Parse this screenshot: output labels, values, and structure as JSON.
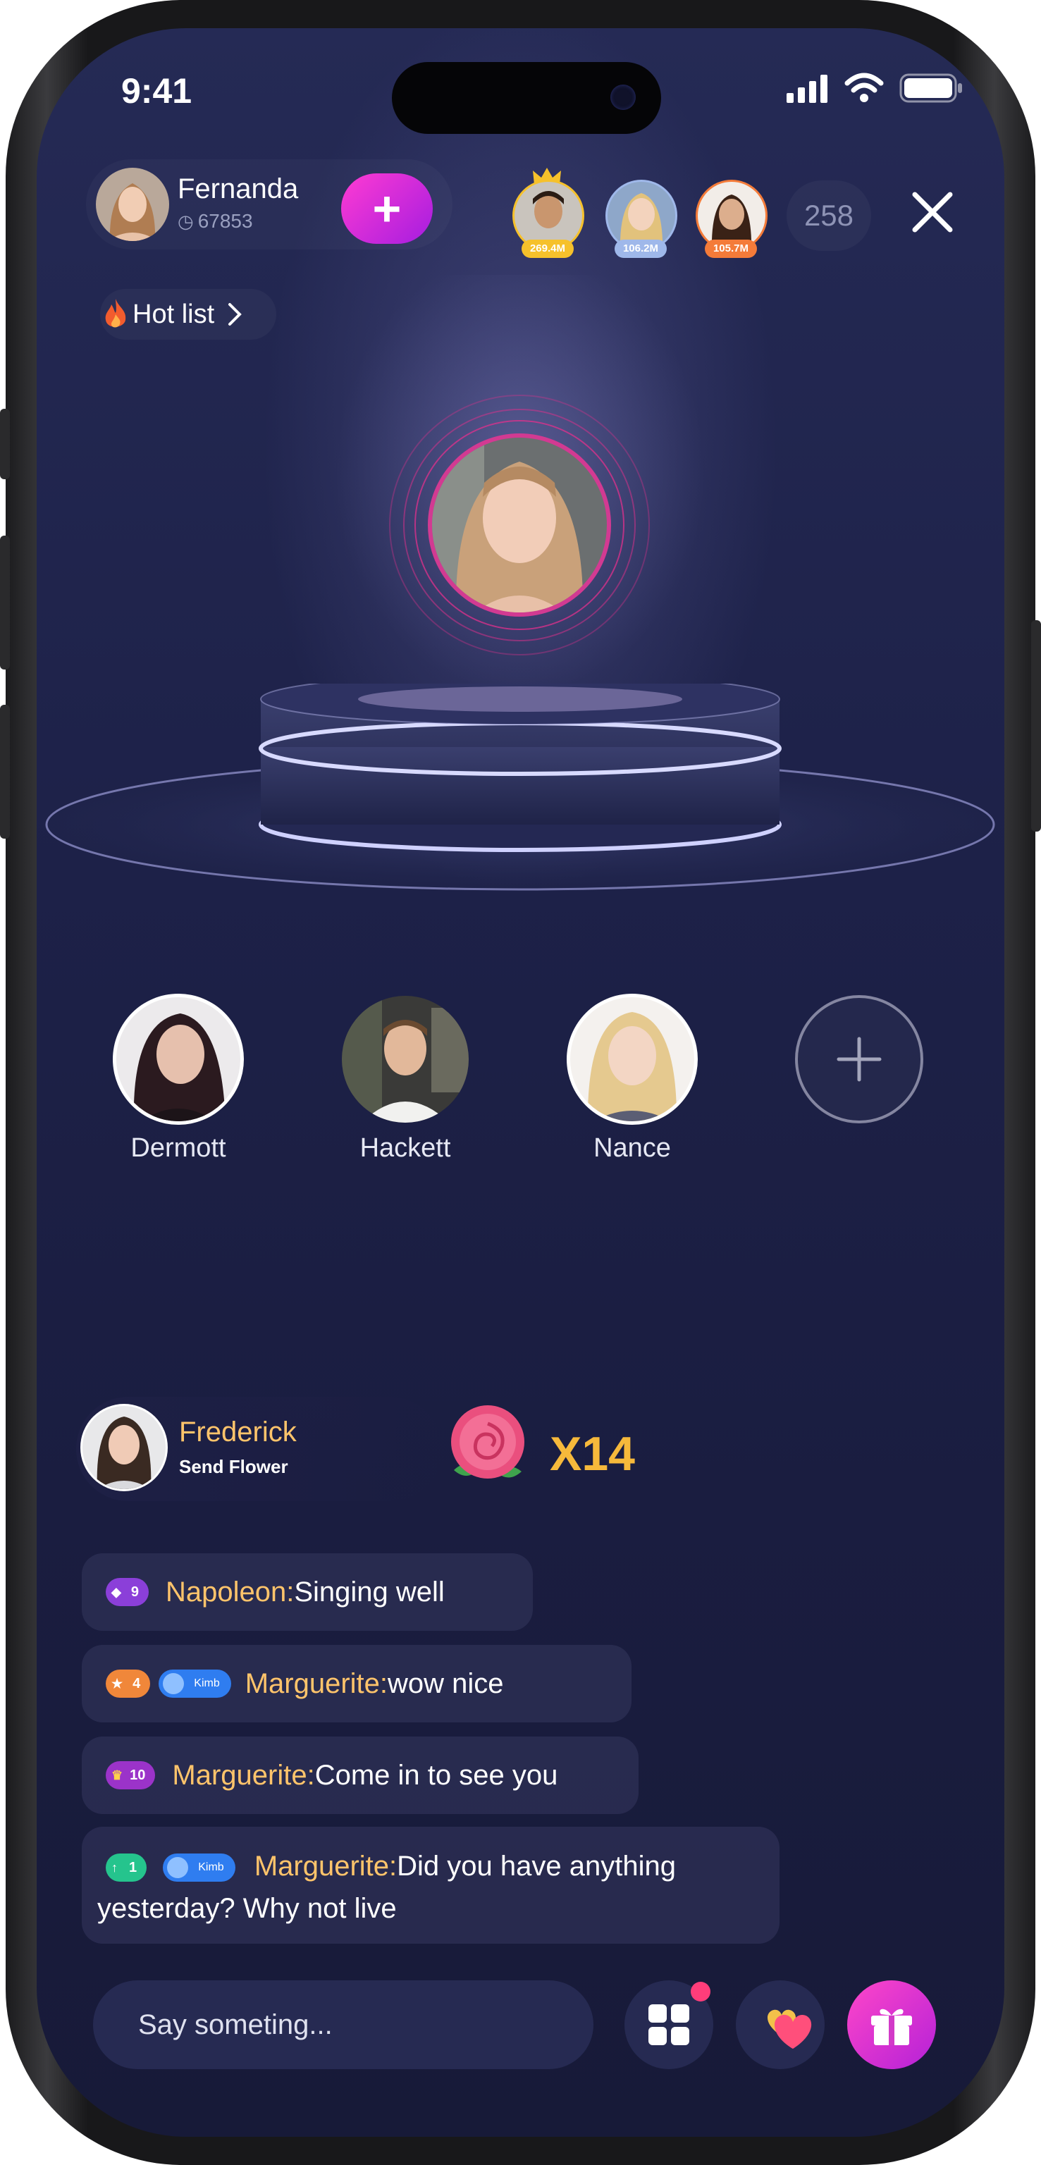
{
  "status_bar": {
    "time": "9:41"
  },
  "host": {
    "name": "Fernanda",
    "id": "67853"
  },
  "viewers": [
    {
      "badge": "269.4M",
      "badge_color": "#f6c12b"
    },
    {
      "badge": "106.2M",
      "badge_color": "#9fb8ea"
    },
    {
      "badge": "105.7M",
      "badge_color": "#f47b39"
    }
  ],
  "viewer_count": "258",
  "hot_list": {
    "label": "Hot list"
  },
  "seats": [
    {
      "name": "Dermott"
    },
    {
      "name": "Hackett"
    },
    {
      "name": "Nance"
    }
  ],
  "gift_notice": {
    "sender": "Frederick",
    "action": "Send Flower",
    "multiplier": "X14"
  },
  "chat": [
    {
      "level": "9",
      "level_color": "#8b3fd9",
      "badge": "",
      "user": "Napoleon:",
      "text": "Singing well"
    },
    {
      "level": "4",
      "level_color": "#f0873a",
      "badge": "Kimb",
      "user": "Marguerite:",
      "text": "wow nice"
    },
    {
      "level": "10",
      "level_color": "#9b33c9",
      "badge": "",
      "user": "Marguerite:",
      "text": "Come in to see you"
    },
    {
      "level": "1",
      "level_color": "#25c48d",
      "badge": "Kimb",
      "user": "Marguerite:",
      "text": "Did you have anything",
      "text2": "yesterday? Why not live"
    }
  ],
  "composer": {
    "placeholder": "Say someting..."
  },
  "colors": {
    "accent": "#e634d6",
    "username": "#ffc46b",
    "background": "#1d2148"
  },
  "icons": [
    "signal-icon",
    "wifi-icon",
    "battery-icon",
    "plus-icon",
    "close-icon",
    "flame-icon",
    "chevron-right-icon",
    "add-seat-icon",
    "rose-icon",
    "apps-icon",
    "hearts-icon",
    "gift-icon"
  ]
}
